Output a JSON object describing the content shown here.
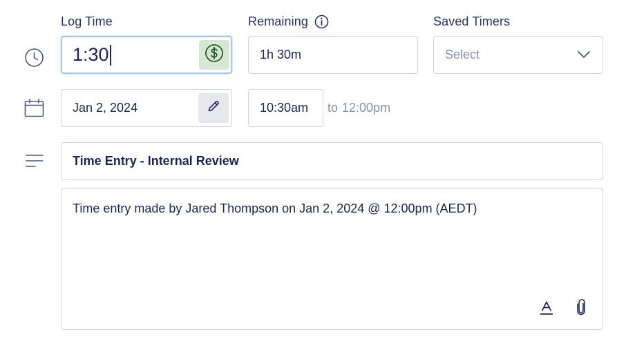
{
  "labels": {
    "log_time": "Log Time",
    "remaining": "Remaining",
    "saved_timers": "Saved Timers"
  },
  "log_time": {
    "value": "1:30"
  },
  "remaining": {
    "value": "1h 30m"
  },
  "saved_timers": {
    "placeholder": "Select"
  },
  "date": {
    "value": "Jan 2, 2024"
  },
  "time_range": {
    "start": "10:30am",
    "connector": "to",
    "end": "12:00pm"
  },
  "title": {
    "value": "Time Entry - Internal Review"
  },
  "description": {
    "value": "Time entry made by Jared Thompson on Jan 2, 2024 @ 12:00pm (AEDT)"
  },
  "colors": {
    "accent_focus": "#a9c8ee",
    "billable_bg": "#d6e8d3",
    "billable_icon": "#1f5a29",
    "text_primary": "#1c2456",
    "text_muted": "#8a90a8",
    "border": "#cfd3dc"
  },
  "icons": {
    "clock": "clock-icon",
    "calendar": "calendar-icon",
    "notes": "notes-lines-icon",
    "info": "info-icon",
    "billable": "dollar-circle-icon",
    "edit": "pencil-icon",
    "dropdown": "chevron-down-icon",
    "text_format": "text-format-icon",
    "attach": "paperclip-icon"
  }
}
